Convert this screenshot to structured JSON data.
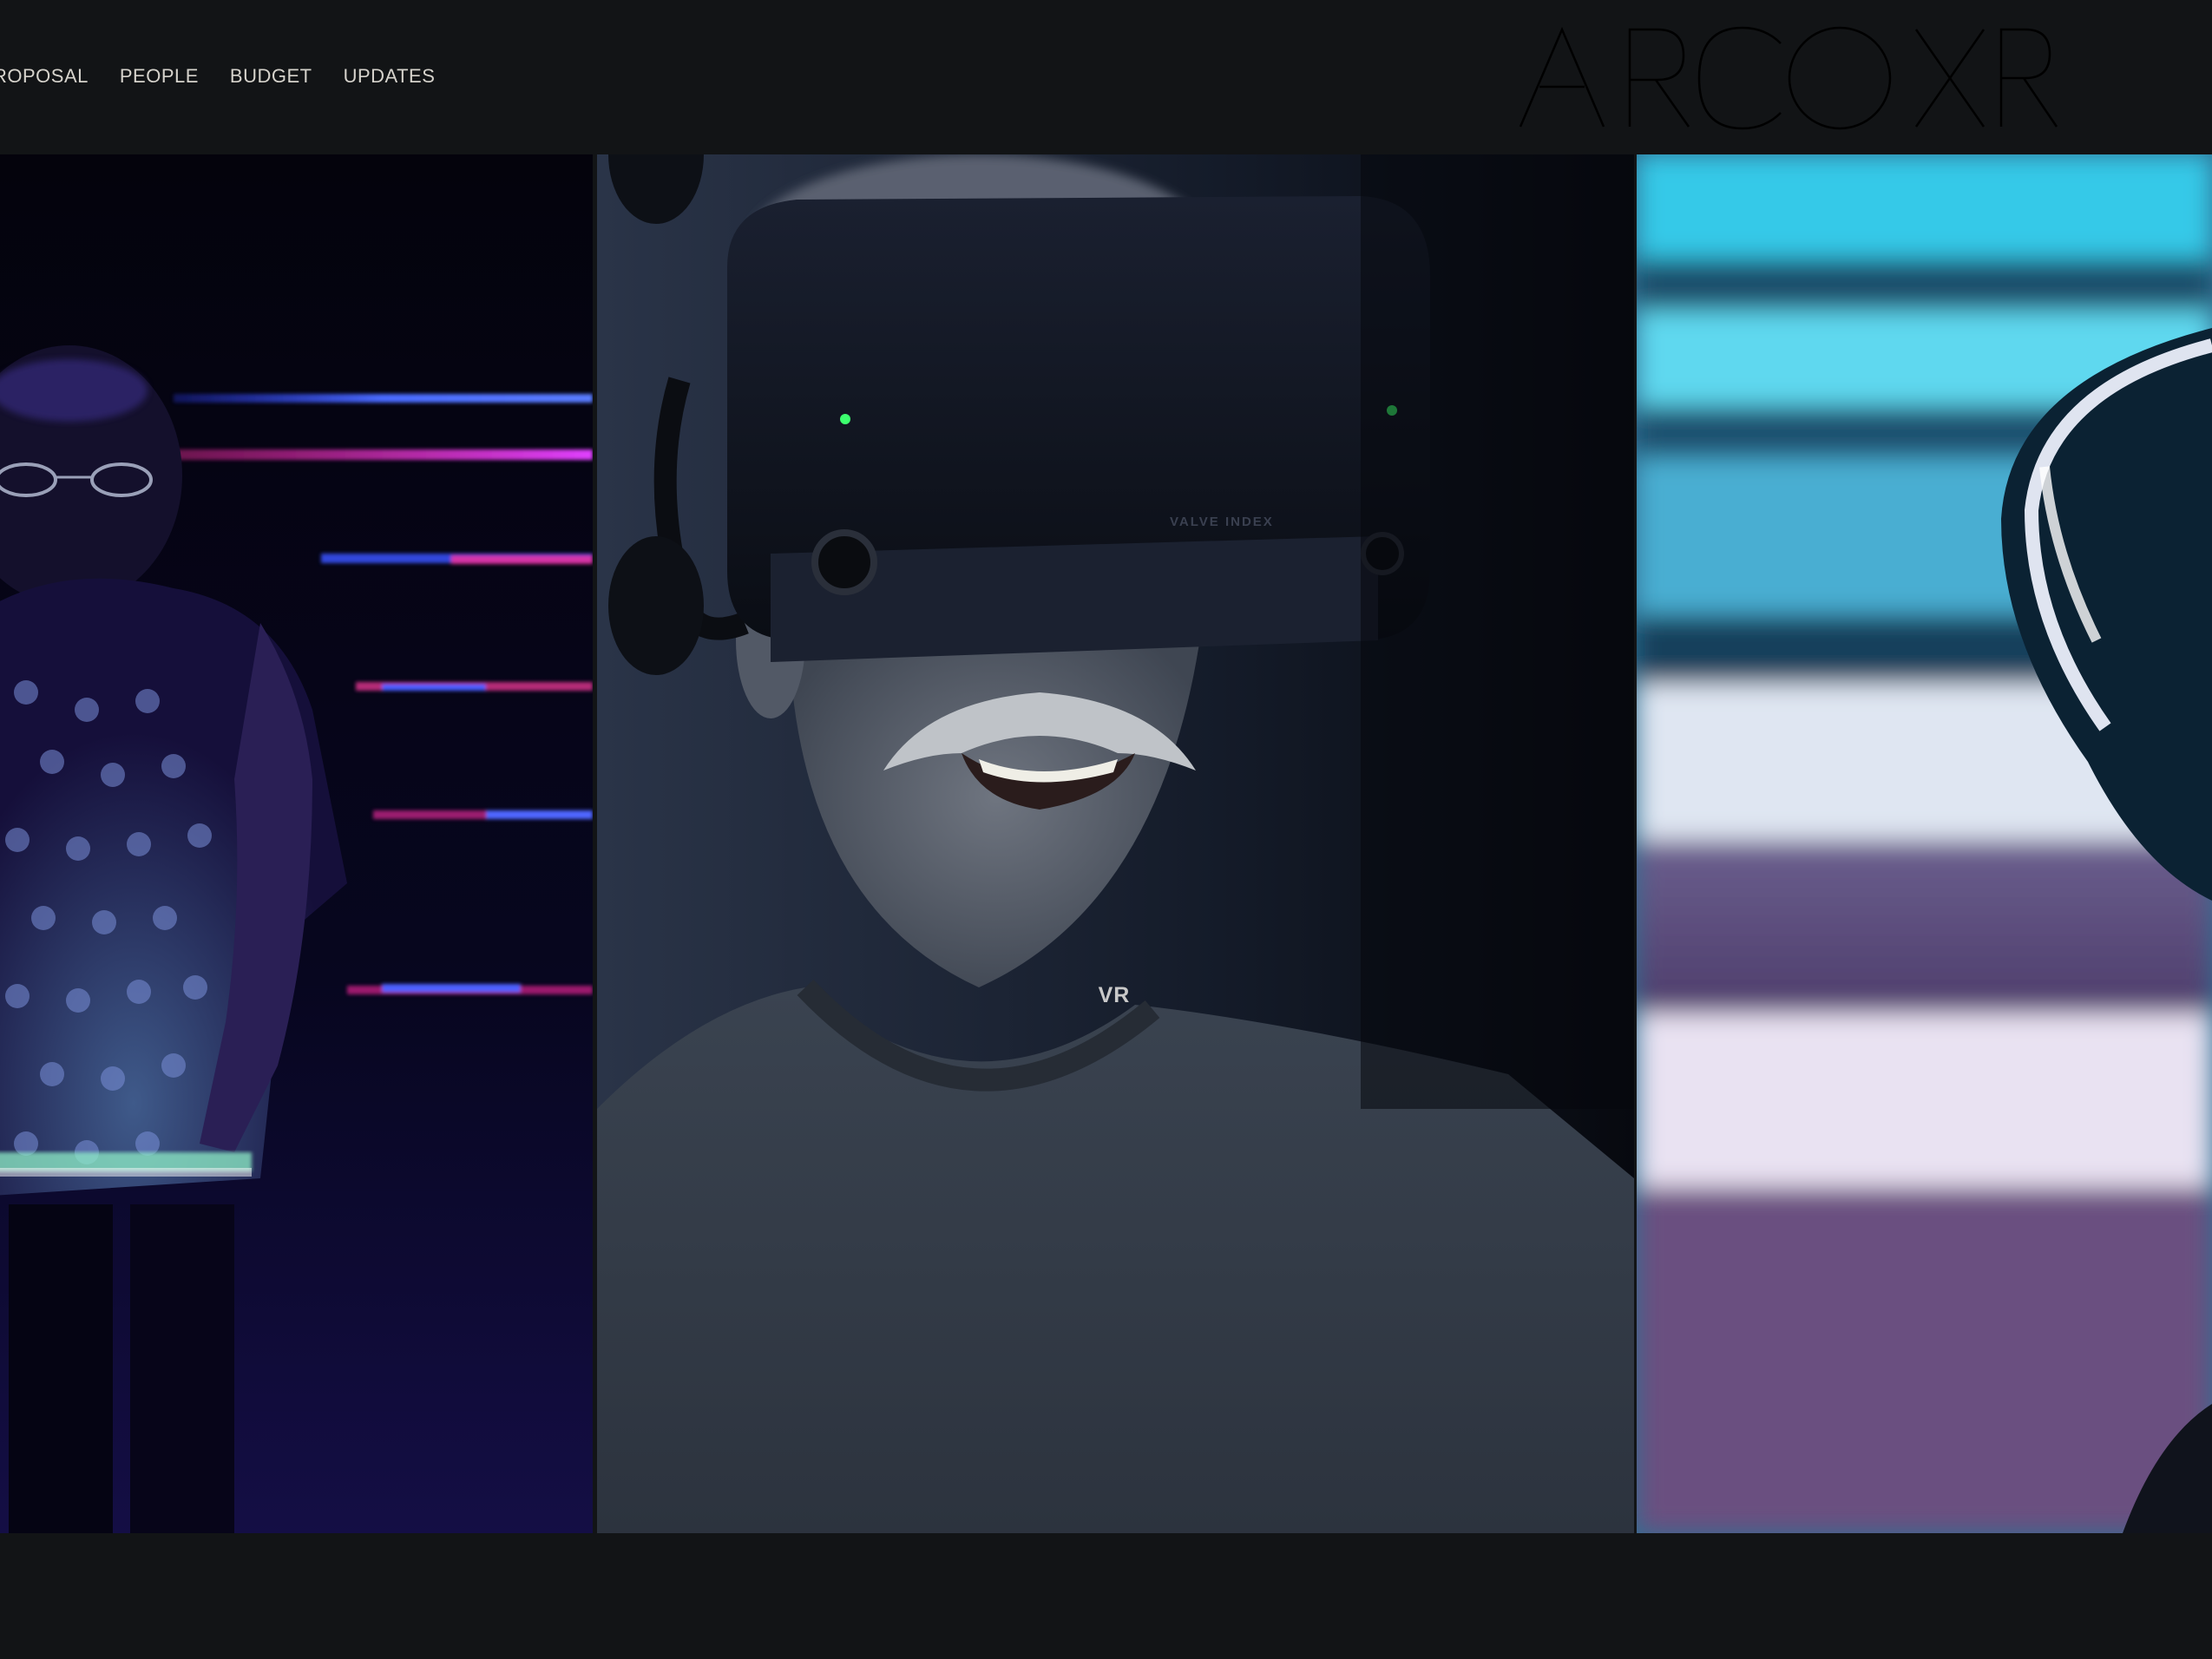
{
  "nav": {
    "items": [
      {
        "label": "ROPOSAL"
      },
      {
        "label": "PEOPLE"
      },
      {
        "label": "BUDGET"
      },
      {
        "label": "UPDATES"
      }
    ]
  },
  "logo": {
    "text": "ARCO XR"
  },
  "gallery": {
    "caption": "VR",
    "headset_brand": "VALVE INDEX"
  },
  "colors": {
    "background": "#121416",
    "nav_text": "#d6d3cc",
    "caption_text": "#c9c9c9"
  }
}
